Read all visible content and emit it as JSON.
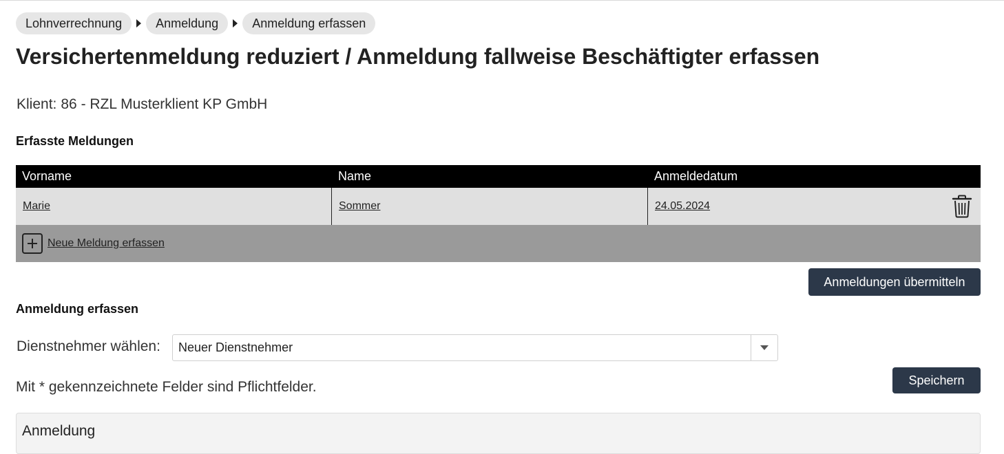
{
  "breadcrumb": [
    {
      "label": "Lohnverrechnung"
    },
    {
      "label": "Anmeldung"
    },
    {
      "label": "Anmeldung erfassen"
    }
  ],
  "page_title": "Versichertenmeldung reduziert / Anmeldung fallweise Beschäftigter erfassen",
  "client": {
    "label": "Klient:",
    "value": "86 - RZL Musterklient KP GmbH"
  },
  "reports_section": {
    "heading": "Erfasste Meldungen",
    "columns": [
      "Vorname",
      "Name",
      "Anmeldedatum"
    ],
    "rows": [
      {
        "vorname": "Marie",
        "name": "Sommer",
        "anmeldedatum": "24.05.2024",
        "action_icon": "trash-icon"
      }
    ],
    "new_entry_label": "Neue Meldung erfassen",
    "new_entry_icon": "plus-icon"
  },
  "submit_button_label": "Anmeldungen übermitteln",
  "form_section": {
    "heading": "Anmeldung erfassen",
    "employee_label": "Dienstnehmer wählen:",
    "employee_selected": "Neuer Dienstnehmer",
    "required_note": "Mit * gekennzeichnete Felder sind Pflichtfelder.",
    "save_label": "Speichern",
    "panel_title": "Anmeldung"
  },
  "colors": {
    "header_bg": "#000000",
    "row_bg": "#e0e0e0",
    "new_row_bg": "#9a9a9a",
    "button_bg": "#2c3849",
    "crumb_bg": "#e6e6e6"
  }
}
